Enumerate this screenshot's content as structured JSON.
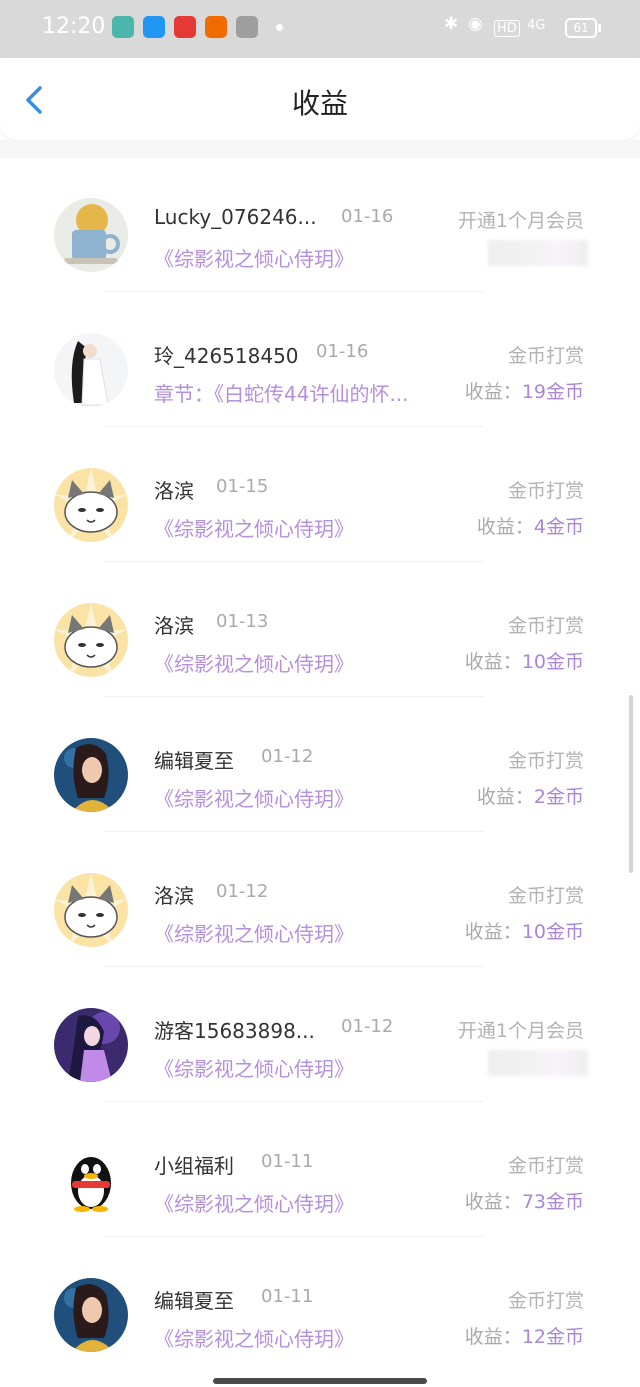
{
  "status_bar": {
    "time": "12:20",
    "hd_label": "HD",
    "signal_label": "4G",
    "battery": "61"
  },
  "header": {
    "title": "收益"
  },
  "colors": {
    "accent": "#a986d6",
    "book": "#b58fd9",
    "muted": "#aaaaaa",
    "back": "#3a8de0"
  },
  "rows": [
    {
      "user": "Lucky_076246...",
      "date": "01-16",
      "book": "《综影视之倾心侍玥》",
      "type": "开通1个月会员",
      "earn_label": "",
      "earn_value": "",
      "avatar": "teacup-avatar"
    },
    {
      "user": "玲_426518450",
      "date": "01-16",
      "book": "章节：《白蛇传44许仙的怀...",
      "type": "金币打赏",
      "earn_label": "收益：",
      "earn_value": "19金币",
      "avatar": "girl-avatar"
    },
    {
      "user": "洛滨",
      "date": "01-15",
      "book": "《综影视之倾心侍玥》",
      "type": "金币打赏",
      "earn_label": "收益：",
      "earn_value": "4金币",
      "avatar": "cat-avatar"
    },
    {
      "user": "洛滨",
      "date": "01-13",
      "book": "《综影视之倾心侍玥》",
      "type": "金币打赏",
      "earn_label": "收益：",
      "earn_value": "10金币",
      "avatar": "cat-avatar"
    },
    {
      "user": "编辑夏至",
      "date": "01-12",
      "book": "《综影视之倾心侍玥》",
      "type": "金币打赏",
      "earn_label": "收益：",
      "earn_value": "2金币",
      "avatar": "editor-avatar"
    },
    {
      "user": "洛滨",
      "date": "01-12",
      "book": "《综影视之倾心侍玥》",
      "type": "金币打赏",
      "earn_label": "收益：",
      "earn_value": "10金币",
      "avatar": "cat-avatar"
    },
    {
      "user": "游客15683898...",
      "date": "01-12",
      "book": "《综影视之倾心侍玥》",
      "type": "开通1个月会员",
      "earn_label": "",
      "earn_value": "",
      "avatar": "anime-avatar"
    },
    {
      "user": "小组福利",
      "date": "01-11",
      "book": "《综影视之倾心侍玥》",
      "type": "金币打赏",
      "earn_label": "收益：",
      "earn_value": "73金币",
      "avatar": "penguin-avatar"
    },
    {
      "user": "编辑夏至",
      "date": "01-11",
      "book": "《综影视之倾心侍玥》",
      "type": "金币打赏",
      "earn_label": "收益：",
      "earn_value": "12金币",
      "avatar": "editor-avatar"
    }
  ]
}
